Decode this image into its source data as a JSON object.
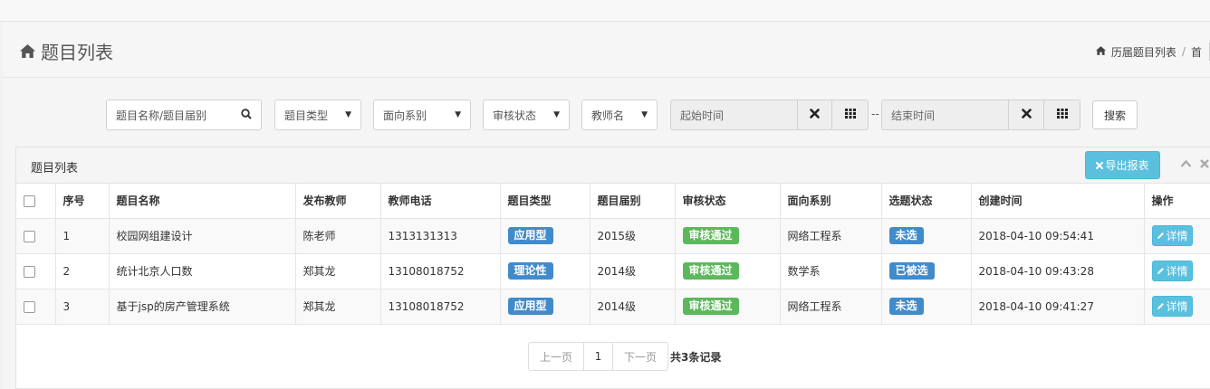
{
  "page": {
    "title": "题目列表",
    "breadcrumb": {
      "current": "历届题目列表",
      "separator": "/",
      "next": "首"
    }
  },
  "filters": {
    "keyword_placeholder": "题目名称/题目届别",
    "type": "题目类型",
    "department": "面向系别",
    "status": "审核状态",
    "teacher": "教师名",
    "start_placeholder": "起始时间",
    "range_sep": "--",
    "end_placeholder": "结束时间",
    "search_label": "搜索"
  },
  "panel": {
    "title": "题目列表",
    "export_label": "导出报表"
  },
  "table": {
    "headers": [
      "序号",
      "题目名称",
      "发布教师",
      "教师电话",
      "题目类型",
      "题目届别",
      "审核状态",
      "面向系别",
      "选题状态",
      "创建时间",
      "操作"
    ],
    "rows": [
      {
        "no": "1",
        "name": "校园网组建设计",
        "teacher": "陈老师",
        "phone": "1313131313",
        "type": "应用型",
        "year": "2015级",
        "review": "审核通过",
        "dept": "网络工程系",
        "select": "未选",
        "created": "2018-04-10 09:54:41",
        "action": "详情"
      },
      {
        "no": "2",
        "name": "统计北京人口数",
        "teacher": "郑其龙",
        "phone": "13108018752",
        "type": "理论性",
        "year": "2014级",
        "review": "审核通过",
        "dept": "数学系",
        "select": "已被选",
        "created": "2018-04-10 09:43:28",
        "action": "详情"
      },
      {
        "no": "3",
        "name": "基于jsp的房产管理系统",
        "teacher": "郑其龙",
        "phone": "13108018752",
        "type": "应用型",
        "year": "2014级",
        "review": "审核通过",
        "dept": "网络工程系",
        "select": "未选",
        "created": "2018-04-10 09:41:27",
        "action": "详情"
      }
    ]
  },
  "pagination": {
    "prev": "上一页",
    "current": "1",
    "next": "下一页",
    "total": "共3条记录"
  },
  "colors": {
    "type_badge": "#428bca",
    "review_badge": "#5cb85c",
    "select_badge": "#428bca",
    "info_button": "#5bc0de"
  },
  "icons": {
    "title": "home-icon",
    "breadcrumb": "home-icon",
    "search": "search-icon",
    "clear": "close-icon",
    "calendar": "grid-icon",
    "export": "close-icon",
    "detail": "pencil-icon"
  }
}
